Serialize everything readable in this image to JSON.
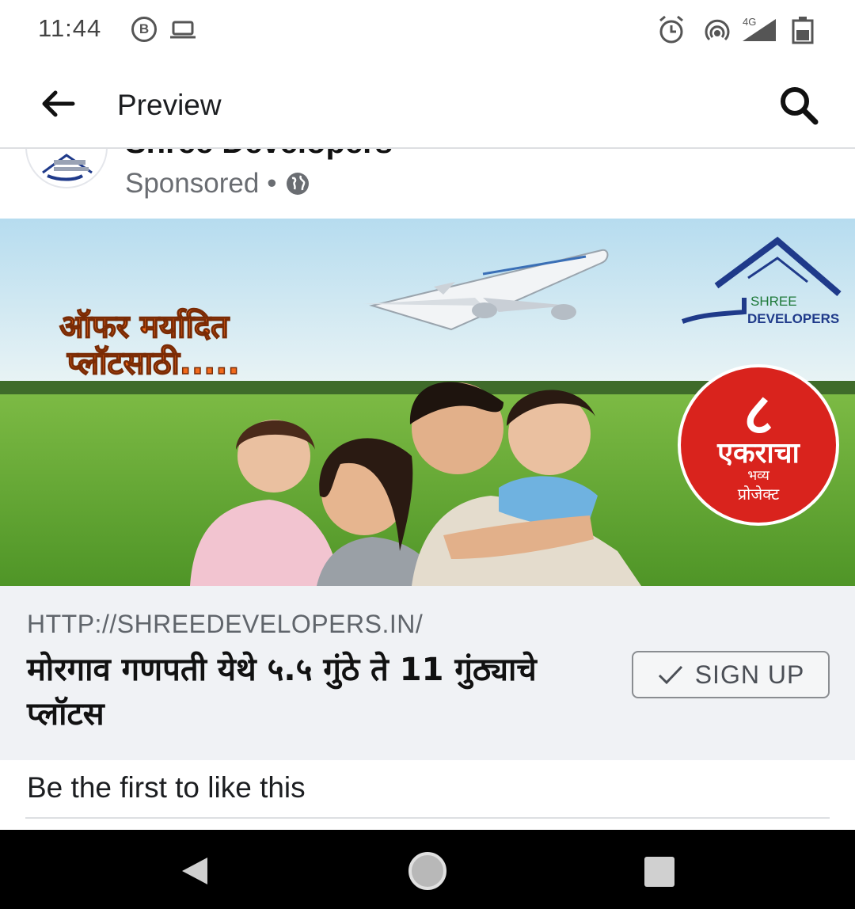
{
  "status_bar": {
    "time": "11:44",
    "b_badge": "B",
    "network_label": "4G",
    "icons": [
      "b-badge-icon",
      "laptop-icon",
      "alarm-icon",
      "hotspot-icon",
      "signal-icon",
      "battery-icon"
    ]
  },
  "app_bar": {
    "title": "Preview",
    "back_icon": "back-arrow-icon",
    "search_icon": "search-icon"
  },
  "post": {
    "page_name": "Shree Developers",
    "sponsored_label": "Sponsored",
    "separator": "•",
    "audience_icon": "globe-icon"
  },
  "ad_image": {
    "offer_line_1": "ऑफर मर्यादित",
    "offer_line_2": "प्लॉटसाठी.....",
    "logo_line_1": "SHREE",
    "logo_line_2": "DEVELOPERS",
    "badge_number": "८",
    "badge_line_1": "एकराचा",
    "badge_line_2": "भव्य",
    "badge_line_3": "प्रोजेक्ट",
    "colors": {
      "sky": "#cfe6f2",
      "grass": "#5da231",
      "badge_red": "#d9231d",
      "offer_orange": "#f26a1b",
      "logo_blue": "#1f3a8a"
    }
  },
  "link": {
    "url": "HTTP://SHREEDEVELOPERS.IN/",
    "headline": "मोरगाव गणपती येथे ५.५ गुंठे ते 11 गुंठ्याचे प्लॉटस",
    "cta_label": "SIGN UP",
    "cta_icon": "check-icon"
  },
  "engagement": {
    "likes_text": "Be the first to like this"
  },
  "nav_bar": {
    "icons": [
      "nav-back-icon",
      "nav-home-icon",
      "nav-recents-icon"
    ]
  }
}
